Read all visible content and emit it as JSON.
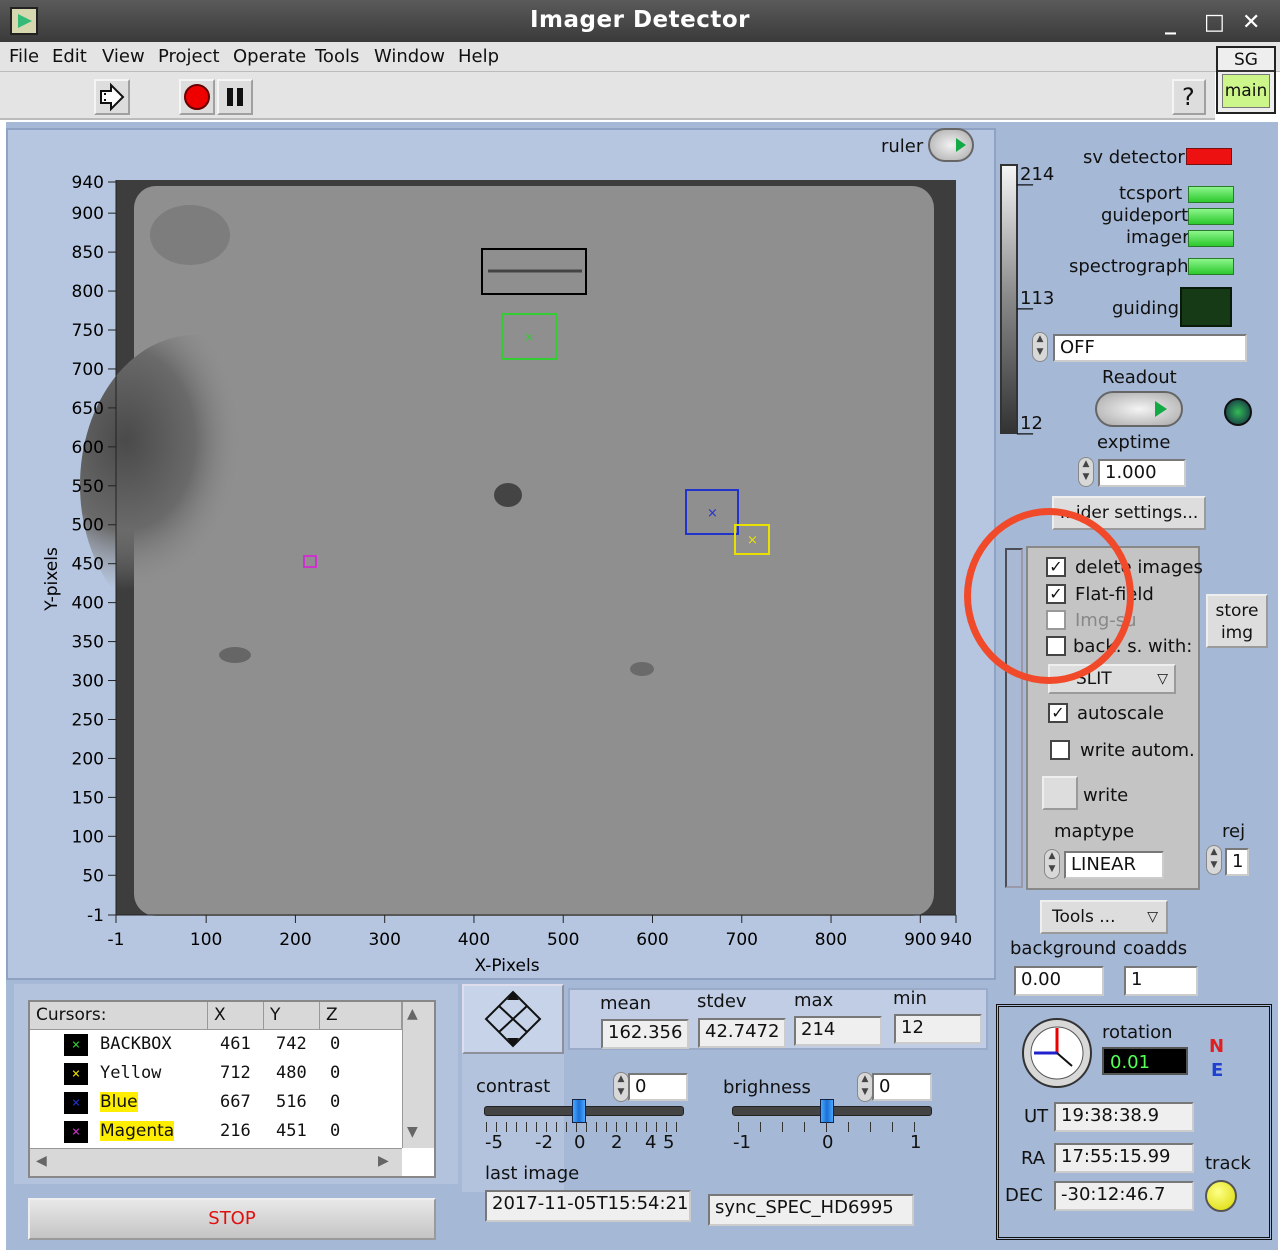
{
  "window": {
    "title": "Imager Detector",
    "controls": [
      "_",
      "□",
      "✕"
    ]
  },
  "menu": [
    "File",
    "Edit",
    "View",
    "Project",
    "Operate",
    "Tools",
    "Window",
    "Help"
  ],
  "sg": {
    "top": "SG",
    "main": "main"
  },
  "help_button": "?",
  "ruler_label": "ruler",
  "plot": {
    "xlabel": "X-Pixels",
    "ylabel": "Y-pixels",
    "xticks": [
      "-1",
      "100",
      "200",
      "300",
      "400",
      "500",
      "600",
      "700",
      "800",
      "900",
      "940"
    ],
    "yticks": [
      "940",
      "900",
      "850",
      "800",
      "750",
      "700",
      "650",
      "600",
      "550",
      "500",
      "450",
      "400",
      "350",
      "300",
      "250",
      "200",
      "150",
      "100",
      "50",
      "-1"
    ]
  },
  "colorbar": {
    "max": "214",
    "mid": "113",
    "min": "12"
  },
  "status": {
    "sv_detector": "sv detector",
    "items": [
      "tcsport",
      "guideport",
      "imager",
      "spectrograph"
    ],
    "guiding": "guiding",
    "guiding_mode": "OFF",
    "readout": "Readout",
    "exptime_label": "exptime",
    "exptime": "1.000",
    "guider_settings": "...ider settings..."
  },
  "options": {
    "delete_images": "delete images",
    "flat_field": "Flat-field",
    "img_sub": "Img-su",
    "back_subs": "back. s. with:",
    "slit": "SLIT",
    "autoscale": "autoscale",
    "write_autom": "write autom.",
    "write": "write",
    "maptype_label": "maptype",
    "maptype": "LINEAR",
    "rej_label": "rej",
    "rej": "1",
    "store_img": [
      "store",
      "img"
    ],
    "tools": "Tools ...",
    "background_label": "background",
    "background": "0.00",
    "coadds_label": "coadds",
    "coadds": "1"
  },
  "cursors": {
    "headers": [
      "Cursors:",
      "X",
      "Y",
      "Z"
    ],
    "rows": [
      {
        "name": "BACKBOX",
        "x": "461",
        "y": "742",
        "z": "0",
        "color": "#33cc33"
      },
      {
        "name": "Yellow",
        "x": "712",
        "y": "480",
        "z": "0",
        "color": "#e8e000"
      },
      {
        "name": "Blue",
        "x": "667",
        "y": "516",
        "z": "0",
        "color": "#2233cc"
      },
      {
        "name": "Magenta",
        "x": "216",
        "y": "451",
        "z": "0",
        "color": "#cc33cc"
      }
    ]
  },
  "stop": "STOP",
  "stats": {
    "labels": [
      "mean",
      "stdev",
      "max",
      "min"
    ],
    "values": [
      "162.356",
      "42.7472",
      "214",
      "12"
    ]
  },
  "contrast": {
    "label": "contrast",
    "value": "0",
    "ticks": [
      "-5",
      "-2",
      "0",
      "2",
      "4",
      "5"
    ]
  },
  "brightness": {
    "label": "brighness",
    "value": "0",
    "ticks": [
      "-1",
      "0",
      "1"
    ]
  },
  "last_image": {
    "label": "last image",
    "value": "2017-11-05T15:54:21",
    "file": "sync_SPEC_HD6995"
  },
  "telescope": {
    "rotation_label": "rotation",
    "rotation": "0.01",
    "n": "N",
    "e": "E",
    "ut_label": "UT",
    "ut": "19:38:38.9",
    "ra_label": "RA",
    "ra": "17:55:15.99",
    "dec_label": "DEC",
    "dec": "-30:12:46.7",
    "track": "track"
  }
}
